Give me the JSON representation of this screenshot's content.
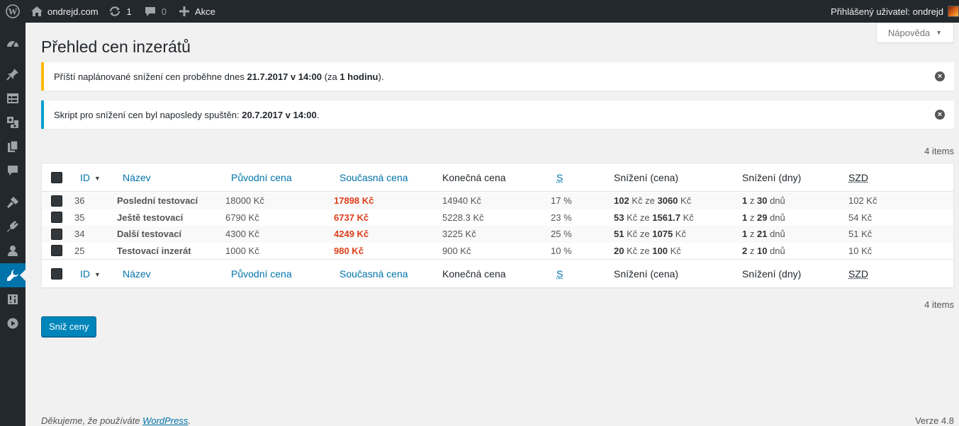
{
  "adminbar": {
    "site_name": "ondrejd.com",
    "updates_count": "1",
    "comments_count": "0",
    "new_label": "Akce",
    "account_label": "Přihlášený uživatel: ondrejd"
  },
  "help_tab": {
    "label": "Nápověda"
  },
  "page": {
    "title": "Přehled cen inzerátů"
  },
  "notices": {
    "warning": {
      "prefix": "Příští naplánované snížení cen proběhne dnes ",
      "datetime": "21.7.2017 v 14:00",
      "middle": " (za ",
      "relative": "1 hodinu",
      "suffix": ")."
    },
    "info": {
      "prefix": "Skript pro snížení cen byl naposledy spuštěn: ",
      "datetime": "20.7.2017 v 14:00",
      "suffix": "."
    }
  },
  "items_count_label": "4 items",
  "table": {
    "columns": {
      "id": "ID",
      "name": "Název",
      "original": "Původní cena",
      "current": "Současná cena",
      "final": "Konečná cena",
      "s": "S",
      "reduction_price": "Snížení (cena)",
      "reduction_days": "Snížení (dny)",
      "szd": "SZD"
    },
    "rows": [
      {
        "id": "36",
        "name": "Poslední testovací",
        "original": "18000 Kč",
        "current": "17898 Kč",
        "final": "14940 Kč",
        "s": "17 %",
        "red_amount": "102",
        "red_total": "3060",
        "day_now": "1",
        "day_total": "30",
        "szd": "102 Kč"
      },
      {
        "id": "35",
        "name": "Ještě testovací",
        "original": "6790 Kč",
        "current": "6737 Kč",
        "final": "5228.3 Kč",
        "s": "23 %",
        "red_amount": "53",
        "red_total": "1561.7",
        "day_now": "1",
        "day_total": "29",
        "szd": "54 Kč"
      },
      {
        "id": "34",
        "name": "Další testovací",
        "original": "4300 Kč",
        "current": "4249 Kč",
        "final": "3225 Kč",
        "s": "25 %",
        "red_amount": "51",
        "red_total": "1075",
        "day_now": "1",
        "day_total": "21",
        "szd": "51 Kč"
      },
      {
        "id": "25",
        "name": "Testovací inzerát",
        "original": "1000 Kč",
        "current": "980 Kč",
        "final": "900 Kč",
        "s": "10 %",
        "red_amount": "20",
        "red_total": "100",
        "day_now": "2",
        "day_total": "10",
        "szd": "10 Kč"
      }
    ],
    "cell_words": {
      "kc": "Kč",
      "ze": "ze",
      "z": "z",
      "dnu": "dnů"
    }
  },
  "button": {
    "label": "Sniž ceny"
  },
  "footer": {
    "thanks_prefix": "Děkujeme, že používáte ",
    "wp_link": "WordPress",
    "thanks_suffix": ".",
    "version": "Verze 4.8"
  },
  "colors": {
    "adminbar_bg": "#23282d",
    "accent": "#0073aa",
    "warning": "#ffb900",
    "info": "#00a0d2",
    "price_red": "#dd3d1a",
    "button": "#0085ba"
  },
  "icons": {
    "adminbar": [
      "wordpress-logo-icon",
      "home-icon",
      "updates-icon",
      "comments-icon",
      "plus-icon"
    ],
    "sidebar": [
      "dashboard-icon",
      "pin-icon",
      "calendar-icon",
      "media-icon",
      "pages-icon",
      "comments-icon",
      "appearance-icon",
      "plugins-icon",
      "users-icon",
      "tools-icon",
      "settings-icon",
      "play-icon"
    ]
  }
}
